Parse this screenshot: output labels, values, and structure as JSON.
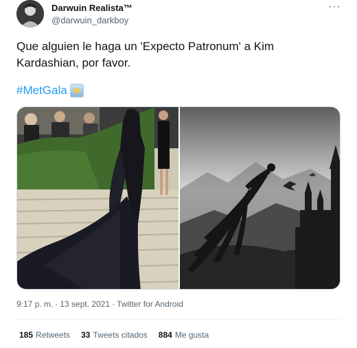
{
  "author": {
    "display_name": "Darwuin Realista™",
    "handle": "@darwuin_darkboy",
    "more_glyph": "···"
  },
  "tweet": {
    "text": "Que alguien le haga un 'Expecto Patronum' a Kim Kardashian, por favor.",
    "hashtag": "#MetGala"
  },
  "media": [
    {
      "name": "black gown on stairs photo"
    },
    {
      "name": "dementor and castle illustration"
    }
  ],
  "meta": {
    "time": "9:17 p. m.",
    "separator1": "·",
    "date": "13 sept. 2021",
    "separator2": "·",
    "source": "Twitter for Android"
  },
  "stats": {
    "retweets_count": "185",
    "retweets_label": "Retweets",
    "quotes_count": "33",
    "quotes_label": "Tweets citados",
    "likes_count": "884",
    "likes_label": "Me gusta"
  },
  "colors": {
    "accent": "#1d9bf0",
    "secondary_text": "#536471",
    "border": "#cfd9de"
  },
  "icons": [
    "more-options-icon",
    "hashflag-icon"
  ]
}
